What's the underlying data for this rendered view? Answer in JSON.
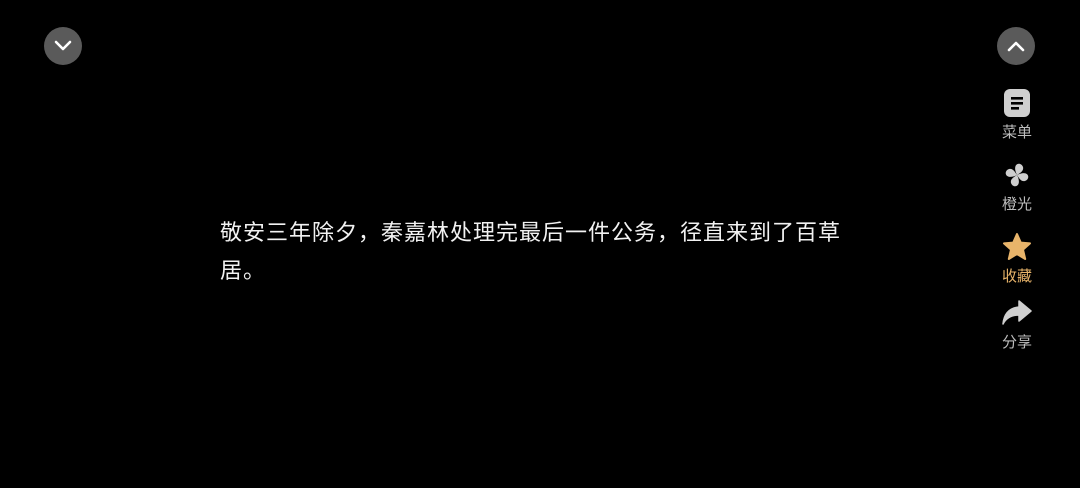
{
  "nav": {
    "collapse_icon": "chevron-down-icon",
    "expand_icon": "chevron-up-icon"
  },
  "story": {
    "text": "敬安三年除夕，秦嘉林处理完最后一件公务，径直来到了百草居。"
  },
  "sidebar": {
    "items": [
      {
        "label": "菜单",
        "icon": "menu-icon"
      },
      {
        "label": "橙光",
        "icon": "orange-light-logo-icon"
      },
      {
        "label": "收藏",
        "icon": "star-icon",
        "accent": "#e8b46a"
      },
      {
        "label": "分享",
        "icon": "share-icon"
      }
    ]
  },
  "colors": {
    "background": "#000000",
    "text": "#f2f2f2",
    "icon": "#cfcfcf",
    "accent": "#e8b46a",
    "button_bg": "#5a5a5a"
  }
}
